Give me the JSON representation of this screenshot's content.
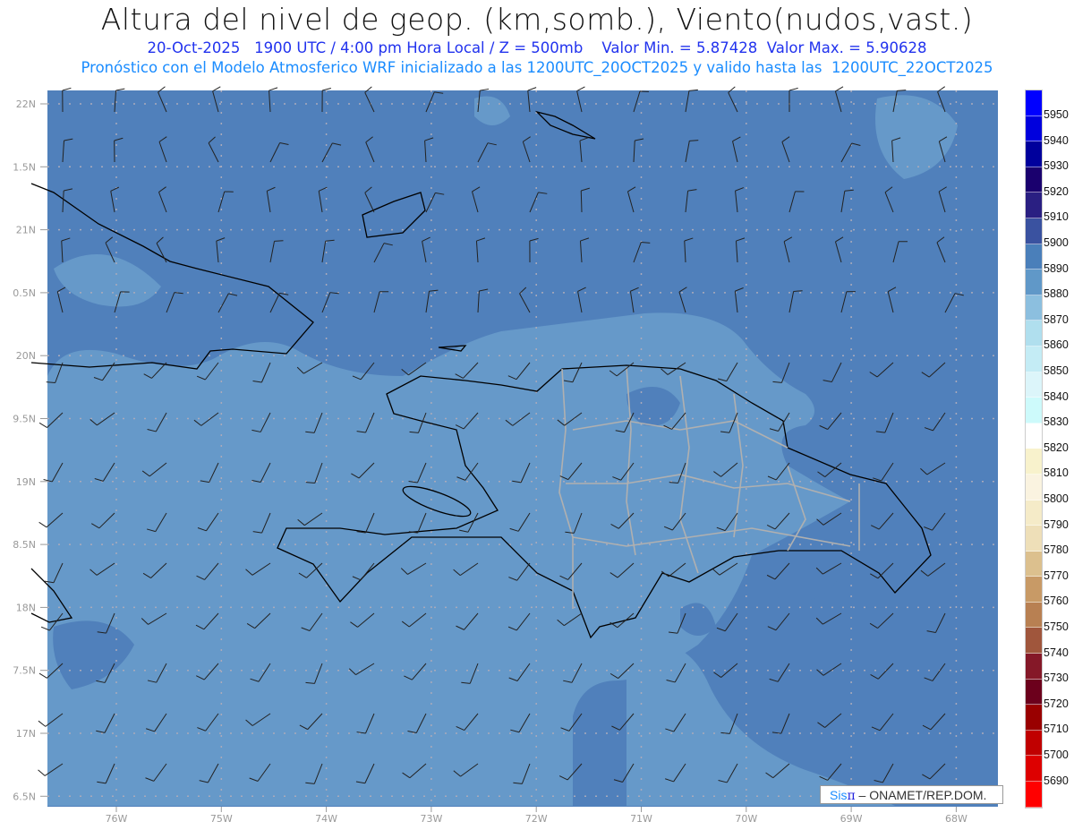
{
  "header": {
    "title": "Altura del nivel de geop. (km,somb.), Viento(nudos,vast.)",
    "subtitle1": "20-Oct-2025   1900 UTC / 4:00 pm Hora Local / Z = 500mb    Valor Min. = 5.87428  Valor Max. = 5.90628",
    "subtitle2": "Pronóstico con el Modelo Atmosferico WRF inicializado a las 1200UTC_20OCT2025 y valido hasta las  1200UTC_22OCT2025"
  },
  "axes": {
    "lat_labels": [
      "22N",
      "1.5N",
      "21N",
      "0.5N",
      "20N",
      "9.5N",
      "19N",
      "8.5N",
      "18N",
      "7.5N",
      "17N",
      "6.5N"
    ],
    "lon_labels": [
      "76W",
      "75W",
      "74W",
      "73W",
      "72W",
      "71W",
      "70W",
      "69W",
      "68W"
    ]
  },
  "colorbar": {
    "labels": [
      "5950",
      "5940",
      "5930",
      "5920",
      "5910",
      "5900",
      "5890",
      "5880",
      "5870",
      "5860",
      "5850",
      "5840",
      "5830",
      "5820",
      "5810",
      "5800",
      "5790",
      "5780",
      "5770",
      "5760",
      "5750",
      "5740",
      "5730",
      "5720",
      "5710",
      "5700",
      "5690"
    ],
    "colors": [
      "#0000ff",
      "#0000dd",
      "#00009c",
      "#1a006e",
      "#2a1f82",
      "#3a52a0",
      "#4a7fba",
      "#6098c8",
      "#8cbfdf",
      "#b0dfee",
      "#c4ecf5",
      "#dcf5fa",
      "#cdfafb",
      "#ffffff",
      "#f8f2cc",
      "#faf3e0",
      "#f5ebc8",
      "#eedfb8",
      "#dcc08e",
      "#c89a66",
      "#b88052",
      "#a0563c",
      "#851828",
      "#6c001c",
      "#990000",
      "#c00000",
      "#dd0000",
      "#ff0000"
    ]
  },
  "footer": {
    "logo_sis": "Sis",
    "logo_pi": "π",
    "logo_text": " –  ONAMET/REP.DOM."
  },
  "colors": {
    "ocean_dark": "#5080bb",
    "ocean_light": "#6699c9"
  }
}
